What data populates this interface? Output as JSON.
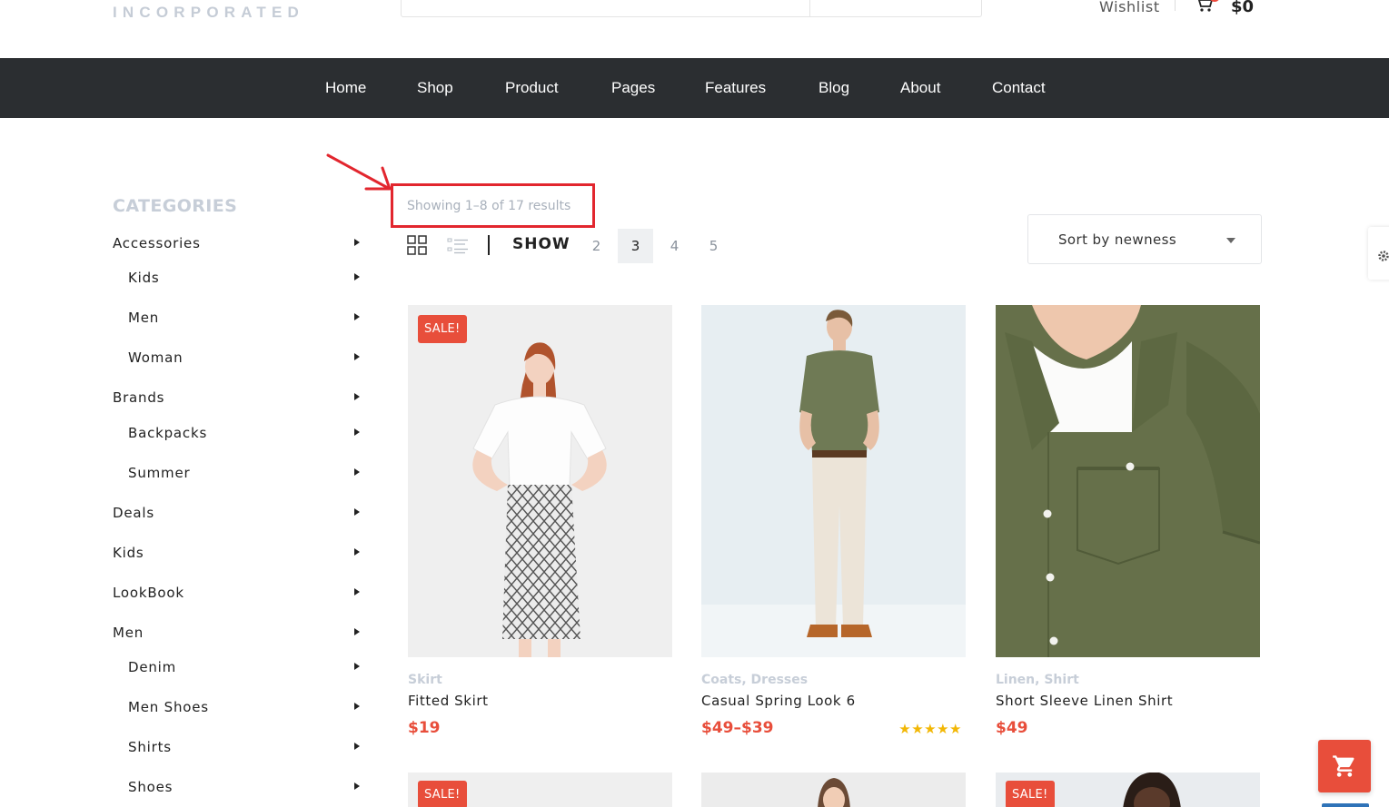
{
  "header": {
    "logo_subtitle": "INCORPORATED",
    "wishlist_label": "Wishlist",
    "cart_total": "$0"
  },
  "nav": {
    "items": [
      "Home",
      "Shop",
      "Product",
      "Pages",
      "Features",
      "Blog",
      "About",
      "Contact"
    ]
  },
  "sidebar": {
    "title": "CATEGORIES",
    "items": [
      {
        "label": "Accessories",
        "level": 0
      },
      {
        "label": "Kids",
        "level": 1
      },
      {
        "label": "Men",
        "level": 1
      },
      {
        "label": "Woman",
        "level": 1
      },
      {
        "label": "Brands",
        "level": 0
      },
      {
        "label": "Backpacks",
        "level": 1
      },
      {
        "label": "Summer",
        "level": 1
      },
      {
        "label": "Deals",
        "level": 0
      },
      {
        "label": "Kids",
        "level": 0
      },
      {
        "label": "LookBook",
        "level": 0
      },
      {
        "label": "Men",
        "level": 0
      },
      {
        "label": "Denim",
        "level": 1
      },
      {
        "label": "Men Shoes",
        "level": 1
      },
      {
        "label": "Shirts",
        "level": 1
      },
      {
        "label": "Shoes",
        "level": 1
      }
    ]
  },
  "toolbar": {
    "results_text": "Showing 1–8 of 17 results",
    "show_label": "SHOW",
    "show_options": [
      "2",
      "3",
      "4",
      "5"
    ],
    "show_selected": "3",
    "sort_label": "Sort by newness"
  },
  "products": [
    {
      "sale": "SALE!",
      "categories": "Skirt",
      "name": "Fitted Skirt",
      "price": "$19",
      "stars": ""
    },
    {
      "sale": "",
      "categories": "Coats, Dresses",
      "name": "Casual Spring Look 6",
      "price": "$49–$39",
      "stars": "★★★★★"
    },
    {
      "sale": "",
      "categories": "Linen, Shirt",
      "name": "Short Sleeve Linen Shirt",
      "price": "$49",
      "stars": ""
    }
  ],
  "products_row2": [
    {
      "sale": "SALE!"
    },
    {
      "sale": ""
    },
    {
      "sale": "SALE!"
    }
  ],
  "colors": {
    "accent": "#e84e3b",
    "nav_bg": "#2b2e31",
    "annotation": "#e2262e",
    "star": "#f2b705",
    "muted": "#c7ced8"
  }
}
